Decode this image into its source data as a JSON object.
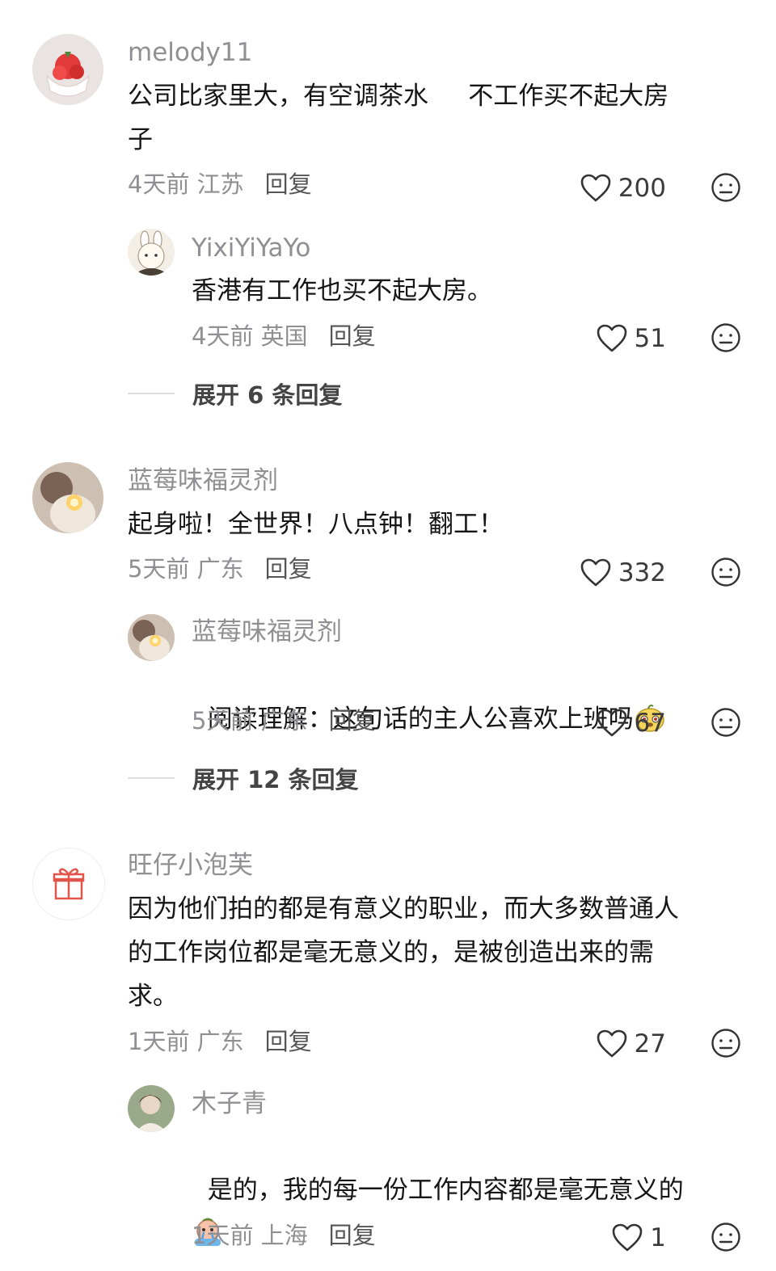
{
  "icons": {
    "like": "heart-outline-icon",
    "dislike": "neutral-face-icon"
  },
  "colors": {
    "muted": "#8f8f94",
    "text": "#161616"
  },
  "comments": [
    {
      "user": "melody11",
      "text": "公司比家里大，有空调茶水     不工作买不起大房\n子",
      "time": "4天前 江苏",
      "reply_label": "回复",
      "likes": "200",
      "replies": [
        {
          "user": "YixiYiYaYo",
          "text": "香港有工作也买不起大房。",
          "time": "4天前 英国",
          "reply_label": "回复",
          "likes": "51"
        }
      ],
      "expand": "展开 6 条回复"
    },
    {
      "user": "蓝莓味福灵剂",
      "text": "起身啦！全世界！八点钟！翻工！",
      "time": "5天前 广东",
      "reply_label": "回复",
      "likes": "332",
      "replies": [
        {
          "user": "蓝莓味福灵剂",
          "text": "阅读理解：这句话的主人公喜欢上班吗",
          "emoji": "cute-face-emoji",
          "time": "5天前 广东",
          "reply_label": "回复",
          "likes": "67"
        }
      ],
      "expand": "展开 12 条回复"
    },
    {
      "user": "旺仔小泡芙",
      "text": "因为他们拍的都是有意义的职业，而大多数普通人\n的工作岗位都是毫无意义的，是被创造出来的需\n求。",
      "time": "1天前 广东",
      "reply_label": "回复",
      "likes": "27",
      "replies": [
        {
          "user": "木子青",
          "text": "是的，我的每一份工作内容都是毫无意义的",
          "emoji": "crying-emoji",
          "time": "1天前 上海",
          "reply_label": "回复",
          "likes": "1"
        }
      ]
    }
  ]
}
